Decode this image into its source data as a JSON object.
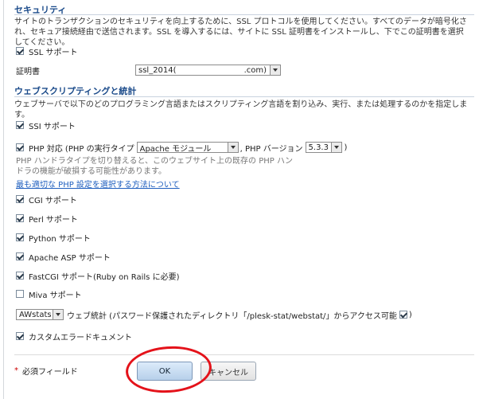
{
  "security": {
    "title": "セキュリティ",
    "desc": "サイトのトランザクションのセキュリティを向上するために、SSL プロトコルを使用してください。すべてのデータが暗号化され、セキュア接続経由で送信されます。SSL を導入するには、サイトに SSL 証明書をインストールし、下でこの証明書を選択してください。",
    "ssl_support": {
      "label": "SSL サポート",
      "checked": true
    },
    "cert": {
      "label": "証明書",
      "value_prefix": "ssl_2014(",
      "value_suffix": ".com)"
    }
  },
  "scripting": {
    "title": "ウェブスクリプティングと統計",
    "desc": "ウェブサーバで以下のどのプログラミング言語またはスクリプティング言語を割り込み、実行、または処理するのかを指定します。",
    "ssi": {
      "label": "SSI サポート",
      "checked": true
    },
    "php": {
      "label_a": "PHP 対応 (PHP の実行タイプ",
      "handler": "Apache モジュール",
      "label_b": ", PHP バージョン",
      "version": "5.3.3",
      "label_c": ")",
      "checked": true,
      "note_line1": "PHP ハンドラタイプを切り替えると、このウェブサイト上の既存の PHP ハン",
      "note_line2": "ドラの機能が破損する可能性があります。",
      "link": "最も適切な PHP 設定を選択する方法について"
    },
    "cgi": {
      "label": "CGI サポート",
      "checked": true
    },
    "perl": {
      "label": "Perl サポート",
      "checked": true
    },
    "python": {
      "label": "Python サポート",
      "checked": true
    },
    "asp": {
      "label": "Apache ASP サポート",
      "checked": true
    },
    "fastcgi": {
      "label": "FastCGI サポート(Ruby on Rails に必要)",
      "checked": true
    },
    "miva": {
      "label": "Miva サポート",
      "checked": false
    },
    "stats": {
      "select": "AWstats",
      "label": "ウェブ統計 (パスワード保護されたディレクトリ「/plesk-stat/webstat/」からアクセス可能",
      "checked": true,
      "close": ")"
    },
    "custom_errors": {
      "label": "カスタムエラードキュメント",
      "checked": true
    }
  },
  "footer": {
    "required_mark": "*",
    "required_label": "必須フィールド",
    "ok": "OK",
    "cancel": "キャンセル"
  },
  "annotation_color": "#e4121a"
}
